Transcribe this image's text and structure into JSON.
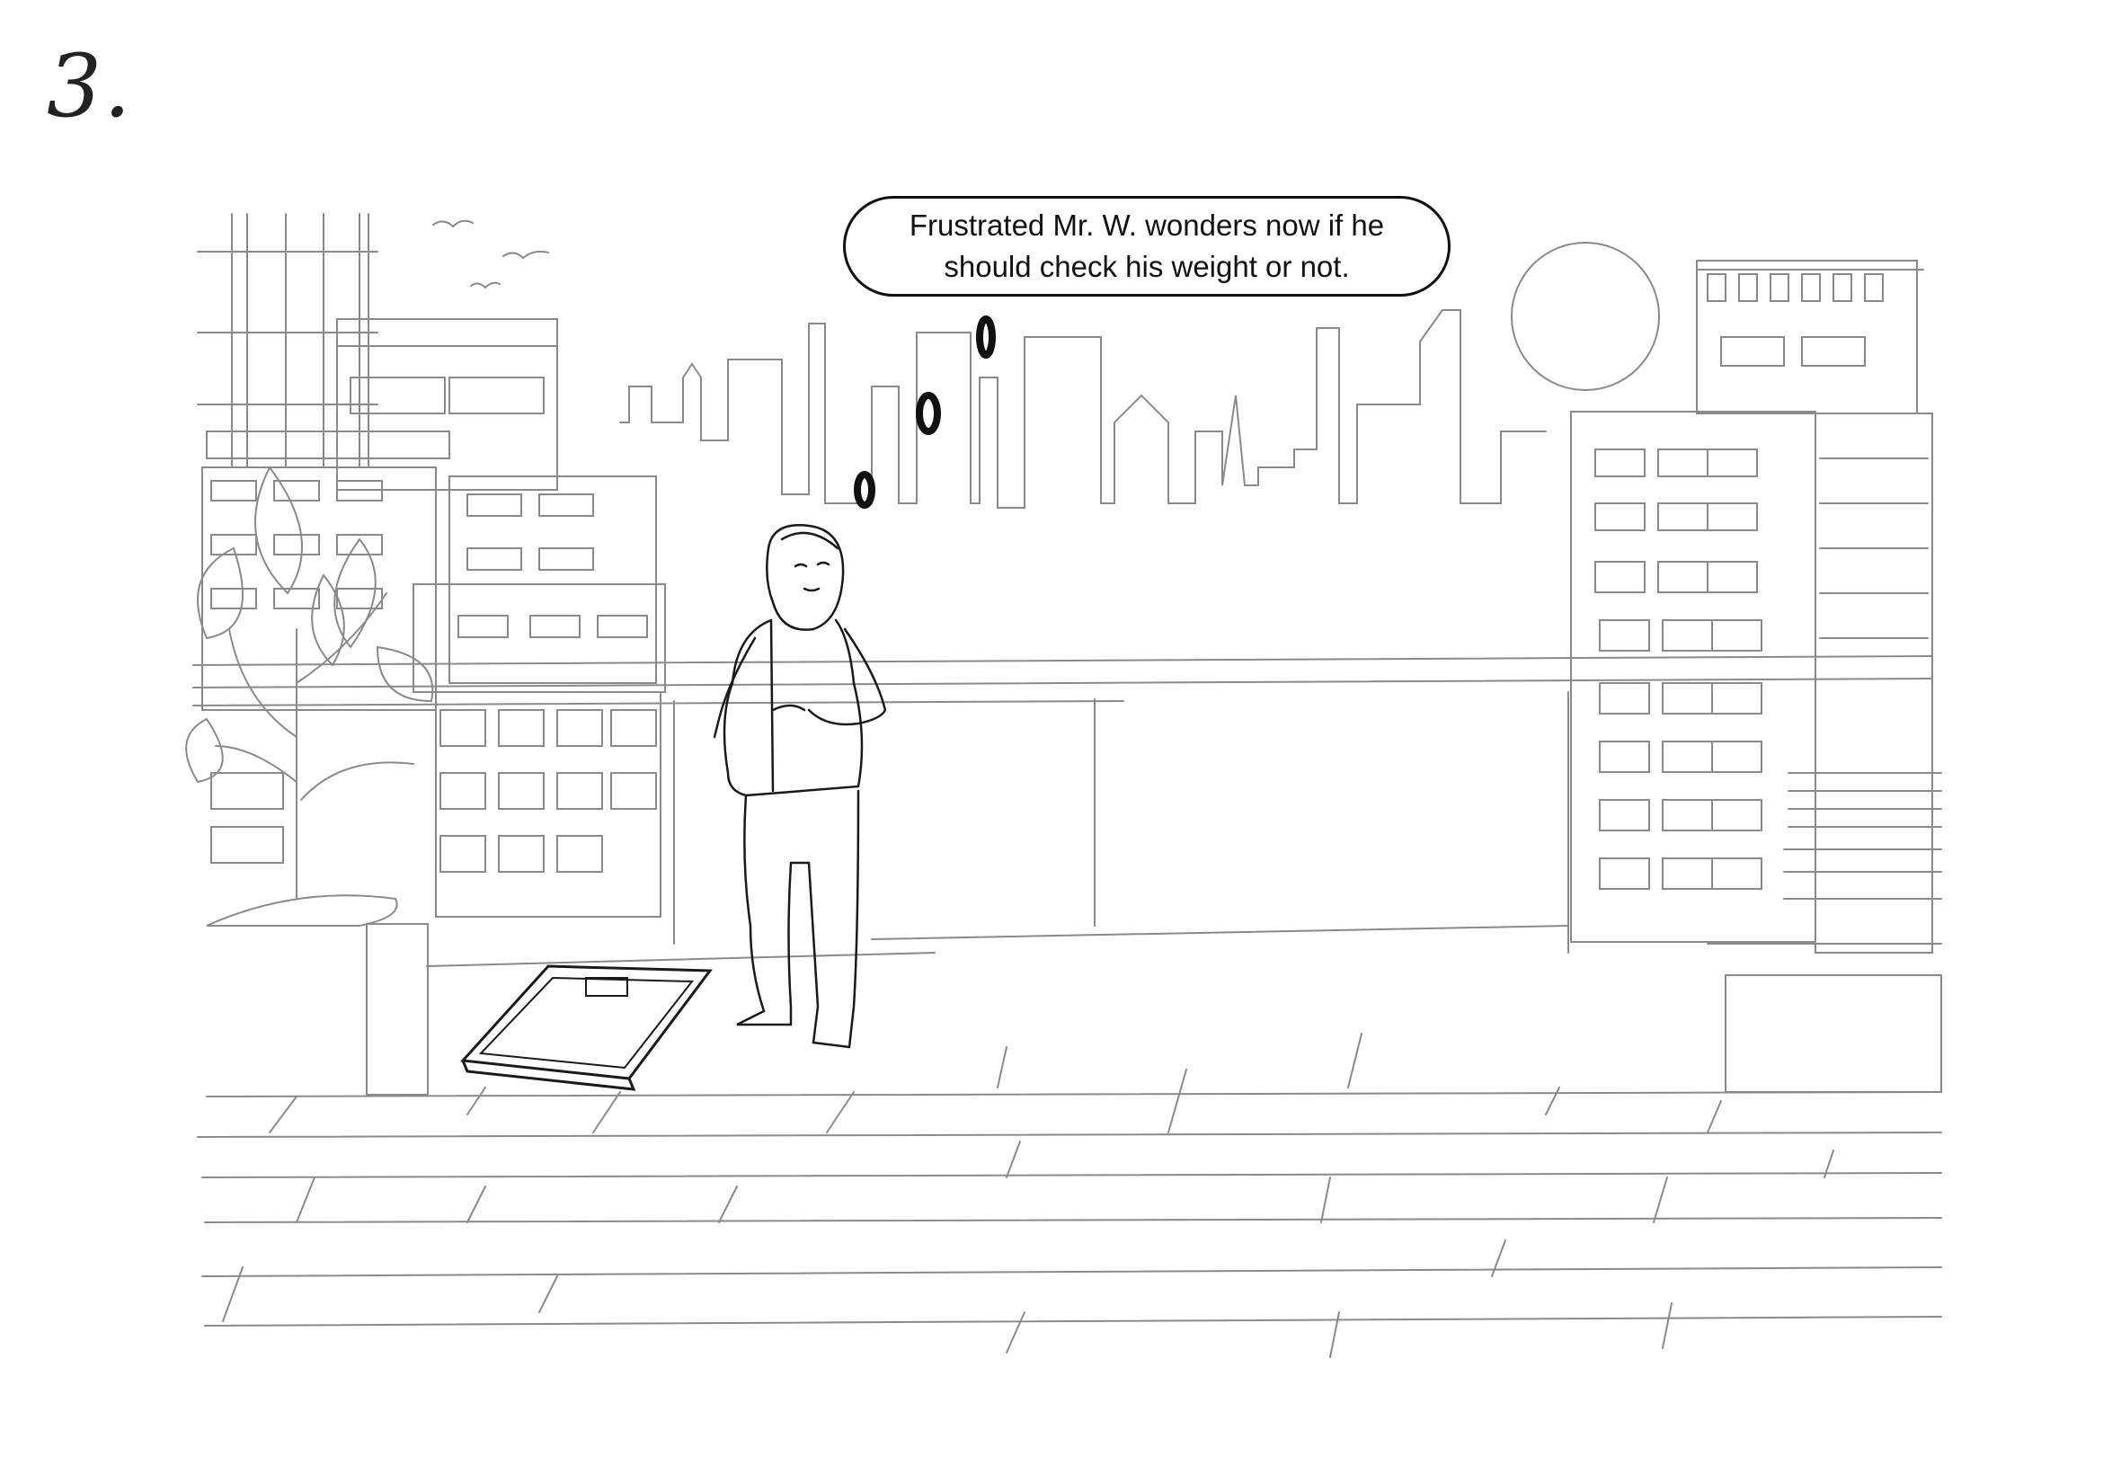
{
  "panel": {
    "number": "3.",
    "caption": "Frustrated Mr. W. wonders now if he\nshould check his weight or not."
  },
  "colors": {
    "ink": "#1a1a1a",
    "pencil": "#8a8a8a",
    "paper": "#ffffff"
  }
}
